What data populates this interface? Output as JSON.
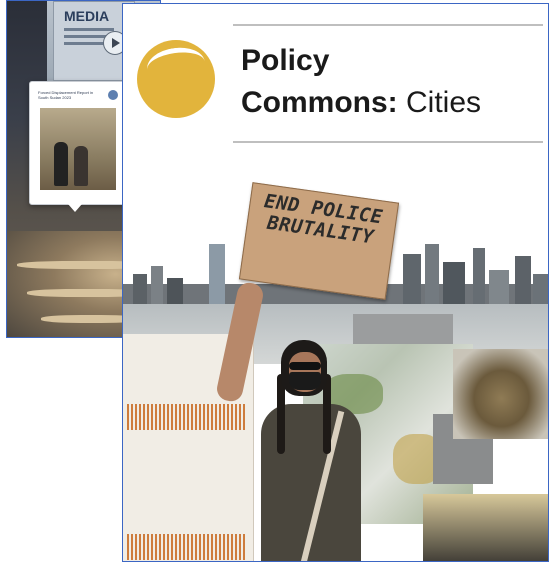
{
  "back_image": {
    "media_text": "MEDIA",
    "tooltip_title": "Forced Displacement Report in South Sudan 2023"
  },
  "front_card": {
    "title_line1": "Policy",
    "title_line2_bold": "Commons:",
    "title_line2_regular": " Cities",
    "sign_text": "END POLICE BRUTALITY"
  },
  "colors": {
    "logo_yellow": "#e2b43c",
    "border_blue": "#3b66c4",
    "rule_gray": "#bfbfbf"
  },
  "icons": {
    "logo": "policy-commons-logo-icon",
    "play": "play-icon"
  }
}
